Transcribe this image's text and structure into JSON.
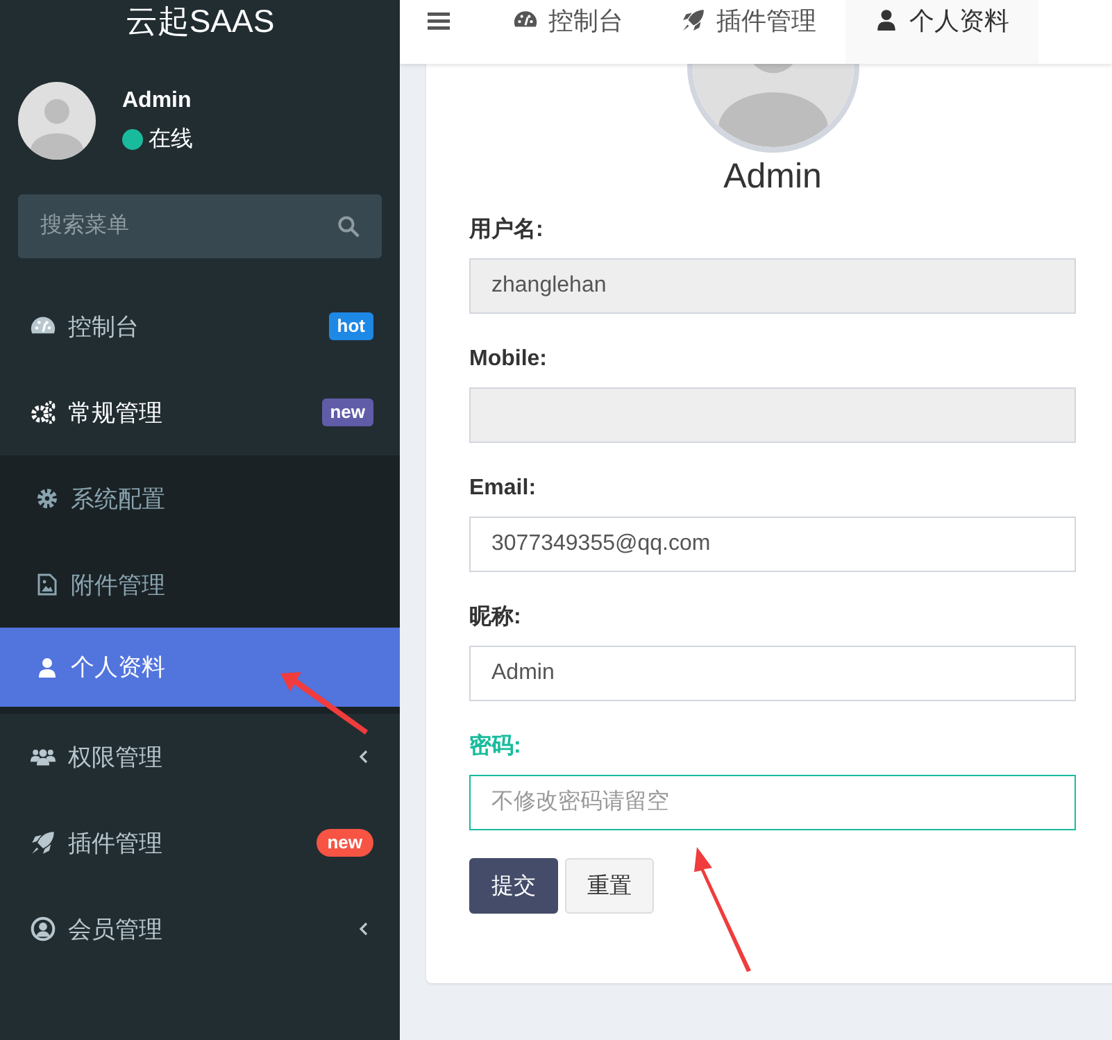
{
  "sidebar": {
    "logo": "云起SAAS",
    "user": {
      "name": "Admin",
      "status": "在线"
    },
    "search": {
      "placeholder": "搜索菜单"
    },
    "menu": [
      {
        "label": "控制台",
        "selected": false,
        "badge": {
          "text": "hot",
          "color": "#1e88e5"
        }
      },
      {
        "label": "常规管理",
        "selected": false,
        "expanded": true,
        "badge": {
          "text": "new",
          "color": "#605ca8"
        },
        "children": [
          {
            "label": "系统配置",
            "selected": false
          },
          {
            "label": "附件管理",
            "selected": false
          },
          {
            "label": "个人资料",
            "selected": true
          }
        ]
      },
      {
        "label": "权限管理",
        "selected": false,
        "expanded": false
      },
      {
        "label": "插件管理",
        "selected": false,
        "badge": {
          "text": "new",
          "color": "#f75444"
        }
      },
      {
        "label": "会员管理",
        "selected": false,
        "expanded": false
      }
    ]
  },
  "tabs": [
    {
      "label": "控制台",
      "selected": false
    },
    {
      "label": "插件管理",
      "selected": false
    },
    {
      "label": "个人资料",
      "selected": true
    }
  ],
  "profile": {
    "name": "Admin",
    "fields": [
      {
        "label": "用户名:",
        "value": "zhanglehan",
        "disabled": true,
        "focused": false
      },
      {
        "label": "Mobile:",
        "disabled": true,
        "focused": false
      },
      {
        "label": "Email:",
        "value": "3077349355@qq.com",
        "disabled": false,
        "focused": false
      },
      {
        "label": "昵称:",
        "value": "Admin",
        "disabled": false,
        "focused": false
      },
      {
        "label": "密码:",
        "placeholder": "不修改密码请留空",
        "disabled": false,
        "focused": true
      }
    ],
    "buttons": [
      {
        "label": "提交",
        "kind": "primary"
      },
      {
        "label": "重置",
        "kind": "default"
      }
    ]
  }
}
